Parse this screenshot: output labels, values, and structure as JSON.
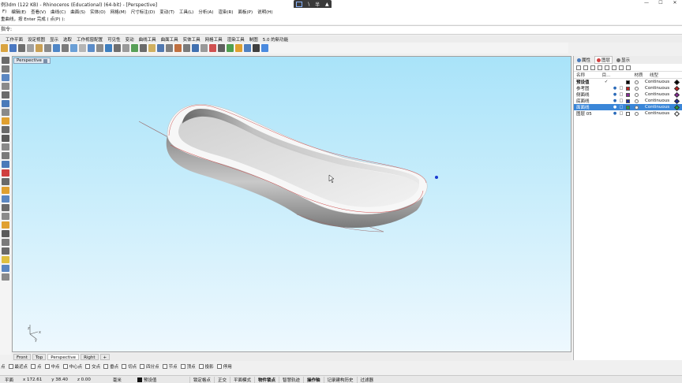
{
  "window": {
    "title": "例3dm (122 KB) - Rhinoceros (Educational) (64-bit) - [Perspective]",
    "controls": [
      "—",
      "☐",
      "✕"
    ]
  },
  "overlay": {
    "symbols": [
      "\\",
      "半"
    ]
  },
  "menu": [
    "F)",
    "编辑(E)",
    "查看(V)",
    "曲线(C)",
    "曲面(S)",
    "实体(O)",
    "网格(M)",
    "尺寸标注(D)",
    "变动(T)",
    "工具(L)",
    "分析(A)",
    "渲染(R)",
    "面板(P)",
    "说明(H)"
  ],
  "command": {
    "history": "重曲线，按 Enter 完成 ( 点(P) ):",
    "prompt": "指令:"
  },
  "toolbar_tabs": [
    "工作平面",
    "设定视图",
    "显示",
    "选取",
    "工作视窗配置",
    "可见性",
    "变动",
    "曲线工具",
    "曲面工具",
    "实体工具",
    "网格工具",
    "渲染工具",
    "制图",
    "5.0 的新功能"
  ],
  "toolbar_icons": [
    "#d9a441",
    "#4a78c2",
    "#6e6e6e",
    "#a0a0a0",
    "#c9a055",
    "#8a8a8a",
    "#4f86c6",
    "#7b7b7b",
    "#6a9fd6",
    "#b5b5b5",
    "#5b8cc9",
    "#8c8c8c",
    "#3f7fbf",
    "#6f6f6f",
    "#9a9a9a",
    "#58a058",
    "#6b6b6b",
    "#d0b060",
    "#5078b0",
    "#808080",
    "#c07040",
    "#7a7a7a",
    "#4070b0",
    "#999",
    "#d05050",
    "#606060",
    "#50a050",
    "#e0a030",
    "#5080c0",
    "#404040",
    "#4a8adf"
  ],
  "left_icons": [
    "#6a6a6a",
    "#7a7a7a",
    "#5b87c2",
    "#8a8a8a",
    "#6a6a6a",
    "#4a7ab9",
    "#8a8a8a",
    "#e0a030",
    "#6a6a6a",
    "#5a5a5a",
    "#8a8a8a",
    "#7a7a7a",
    "#4a7ab9",
    "#d04040",
    "#6a6a6a",
    "#e0a030",
    "#5b87c2",
    "#6a6a6a",
    "#8a8a8a",
    "#e0a030",
    "#5a5a5a",
    "#7a7a7a",
    "#6a6a6a",
    "#e0c040",
    "#5b87c2",
    "#8a8a8a"
  ],
  "viewport": {
    "label": "Perspective",
    "axes": {
      "z": "z",
      "x": "x",
      "y": "y"
    }
  },
  "view_tabs": [
    "Front",
    "Top",
    "Perspective",
    "Right",
    "+"
  ],
  "osnaps": [
    {
      "label": "点",
      "checked": false,
      "has_box": false
    },
    {
      "label": "最近点",
      "checked": false,
      "has_box": true
    },
    {
      "label": "点",
      "checked": false,
      "has_box": true
    },
    {
      "label": "中点",
      "checked": false,
      "has_box": true
    },
    {
      "label": "中心点",
      "checked": false,
      "has_box": true
    },
    {
      "label": "交点",
      "checked": false,
      "has_box": true
    },
    {
      "label": "垂点",
      "checked": false,
      "has_box": true
    },
    {
      "label": "切点",
      "checked": false,
      "has_box": true
    },
    {
      "label": "四分点",
      "checked": false,
      "has_box": true
    },
    {
      "label": "节点",
      "checked": false,
      "has_box": true
    },
    {
      "label": "顶点",
      "checked": false,
      "has_box": true
    },
    {
      "label": "投影",
      "checked": false,
      "has_box": true
    },
    {
      "label": "停用",
      "checked": false,
      "has_box": true
    }
  ],
  "status": {
    "cplane": "平面",
    "x": "x 172.61",
    "y": "y 38.40",
    "z": "z 0.00",
    "units": "毫米",
    "layer": "预设值",
    "toggles": [
      {
        "label": "锁定格点",
        "bold": false
      },
      {
        "label": "正交",
        "bold": false
      },
      {
        "label": "平面模式",
        "bold": false
      },
      {
        "label": "物件锁点",
        "bold": true
      },
      {
        "label": "智慧轨迹",
        "bold": false
      },
      {
        "label": "操作轴",
        "bold": true
      },
      {
        "label": "记录建构历史",
        "bold": false
      },
      {
        "label": "过滤器",
        "bold": false
      }
    ]
  },
  "panel": {
    "tabs": [
      {
        "label": "属性",
        "color": "#4a7ab9",
        "active": false
      },
      {
        "label": "图层",
        "color": "#d04040",
        "active": true
      },
      {
        "label": "显示",
        "color": "#707070",
        "active": false
      }
    ],
    "headers": {
      "name": "名称",
      "current": "目...",
      "material": "材质",
      "linetype": "线型"
    },
    "layers": [
      {
        "name": "预设值",
        "current": "✓",
        "color": "#000000",
        "linetype": "Continuous",
        "pw": "#000000",
        "bold": true,
        "selected": false,
        "show_icons": false
      },
      {
        "name": "参考图",
        "current": "",
        "color": "#c02020",
        "linetype": "Continuous",
        "pw": "#c02020",
        "bold": false,
        "selected": false,
        "show_icons": true
      },
      {
        "name": "侧面线",
        "current": "",
        "color": "#8a2a9a",
        "linetype": "Continuous",
        "pw": "#8a2a9a",
        "bold": false,
        "selected": false,
        "show_icons": true
      },
      {
        "name": "底面线",
        "current": "",
        "color": "#2030a0",
        "linetype": "Continuous",
        "pw": "#2030a0",
        "bold": false,
        "selected": false,
        "show_icons": true
      },
      {
        "name": "面面线",
        "current": "",
        "color": "#20a040",
        "linetype": "Continuous",
        "pw": "#20a040",
        "bold": false,
        "selected": true,
        "show_icons": true
      },
      {
        "name": "图层 05",
        "current": "",
        "color": "#ffffff",
        "linetype": "Continuous",
        "pw": "#ffffff",
        "bold": false,
        "selected": false,
        "show_icons": true
      }
    ]
  }
}
